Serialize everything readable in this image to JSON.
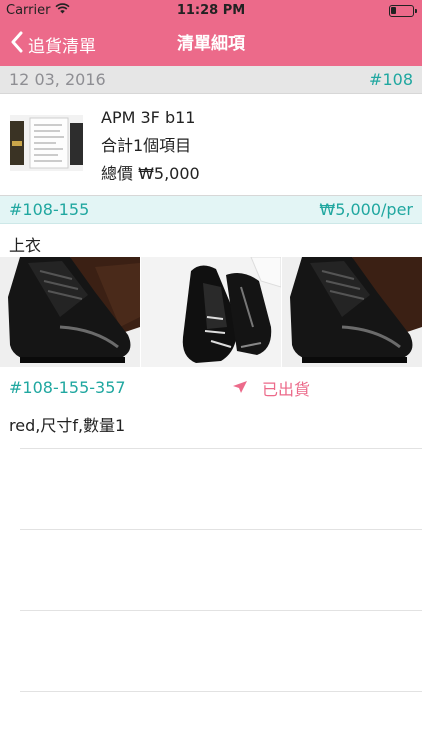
{
  "status_bar": {
    "carrier": "Carrier",
    "time": "11:28 PM",
    "battery_level": 0.25
  },
  "nav": {
    "back_label": "追貨清單",
    "title": "清單細項",
    "icons": {
      "back": "chevron-left-icon"
    },
    "bar_color": "#ec6a8a"
  },
  "order": {
    "date": "12 03, 2016",
    "number": "#108"
  },
  "store": {
    "name": "APM 3F b11",
    "items_total": "合計1個項目",
    "total_price": "總價 ₩5,000"
  },
  "item": {
    "code": "#108-155",
    "unit_price": "₩5,000/per",
    "category": "上衣",
    "photos": [
      "black-leather-boot",
      "black-patent-slip-on",
      "black-leather-boot"
    ]
  },
  "variant": {
    "code": "#108-155-357",
    "status": "已出貨",
    "status_icon": "send-arrow-icon",
    "description": "red,尺寸f,數量1"
  },
  "colors": {
    "accent": "#ec6a8a",
    "teal": "#20a7a0"
  }
}
